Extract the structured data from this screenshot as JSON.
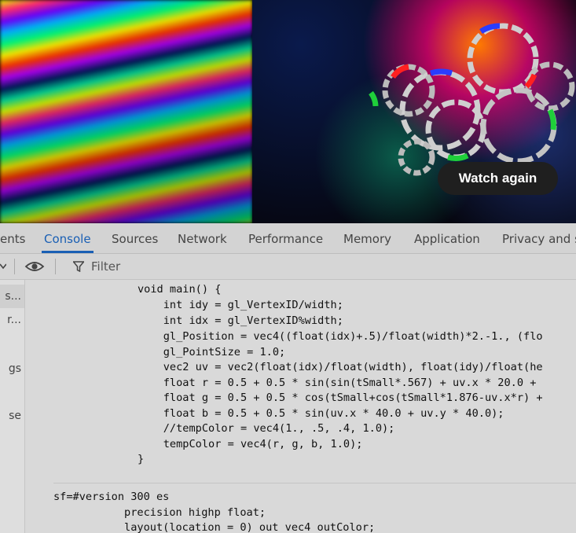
{
  "video": {
    "watch_again_label": "Watch again"
  },
  "devtools": {
    "tabs": [
      "ents",
      "Console",
      "Sources",
      "Network",
      "Performance",
      "Memory",
      "Application",
      "Privacy and s"
    ],
    "active_tab": "Console",
    "filter_placeholder": "Filter",
    "sidebar_items": [
      "s...",
      "r...",
      "gs",
      "se"
    ],
    "console_lines": [
      "void main() {",
      "    int idy = gl_VertexID/width;",
      "    int idx = gl_VertexID%width;",
      "    gl_Position = vec4((float(idx)+.5)/float(width)*2.-1., (flo",
      "    gl_PointSize = 1.0;",
      "    vec2 uv = vec2(float(idx)/float(width), float(idy)/float(he",
      "    float r = 0.5 + 0.5 * sin(sin(tSmall*.567) + uv.x * 20.0 +",
      "    float g = 0.5 + 0.5 * cos(tSmall+cos(tSmall*1.876-uv.x*r) +",
      "    float b = 0.5 + 0.5 * sin(uv.x * 40.0 + uv.y * 40.0);",
      "    //tempColor = vec4(1., .5, .4, 1.0);",
      "    tempColor = vec4(r, g, b, 1.0);",
      "}"
    ],
    "second_message": [
      "sf=#version 300 es",
      "           precision highp float;",
      "           layout(location = 0) out vec4 outColor;"
    ]
  }
}
